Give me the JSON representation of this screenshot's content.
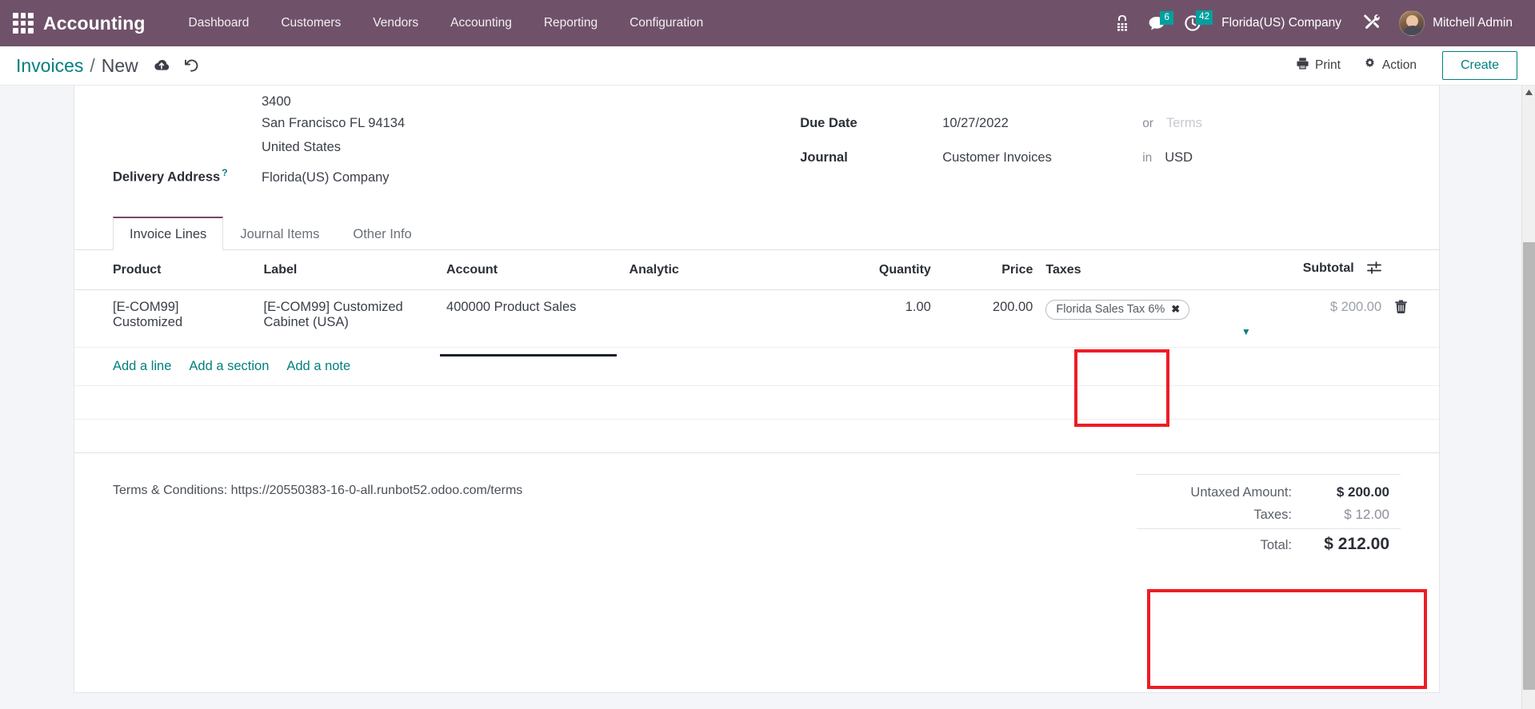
{
  "navbar": {
    "apps_icon": "apps-grid-icon",
    "brand": "Accounting",
    "menu": [
      {
        "label": "Dashboard"
      },
      {
        "label": "Customers"
      },
      {
        "label": "Vendors"
      },
      {
        "label": "Accounting"
      },
      {
        "label": "Reporting"
      },
      {
        "label": "Configuration"
      }
    ],
    "icons": {
      "voip": "phone-dialpad-icon",
      "messages": "chat-bubble-icon",
      "activities": "clock-icon",
      "tools": "wrench-screwdriver-icon"
    },
    "messages_count": "6",
    "activities_count": "42",
    "company": "Florida(US) Company",
    "user": "Mitchell Admin",
    "badge_color": "#00a09d",
    "bg_color": "#6f526a"
  },
  "control_panel": {
    "breadcrumb_root": "Invoices",
    "breadcrumb_sep": "/",
    "breadcrumb_current": "New",
    "save_icon": "cloud-upload-icon",
    "discard_icon": "undo-icon",
    "print_label": "Print",
    "print_icon": "printer-icon",
    "action_label": "Action",
    "action_icon": "gear-icon",
    "create_label": "Create",
    "accent_color": "#00807f"
  },
  "form": {
    "address_lines": [
      "3400",
      "San Francisco FL 94134",
      "United States"
    ],
    "delivery_address_label": "Delivery Address",
    "delivery_address_help": "?",
    "delivery_address_value": "Florida(US) Company",
    "due_date_label": "Due Date",
    "due_date_value": "10/27/2022",
    "due_date_conj": "or",
    "terms_placeholder": "Terms",
    "journal_label": "Journal",
    "journal_value": "Customer Invoices",
    "journal_conj": "in",
    "currency": "USD"
  },
  "tabs": [
    {
      "label": "Invoice Lines",
      "active": true
    },
    {
      "label": "Journal Items",
      "active": false
    },
    {
      "label": "Other Info",
      "active": false
    }
  ],
  "lines_table": {
    "columns": {
      "product": "Product",
      "label": "Label",
      "account": "Account",
      "analytic": "Analytic",
      "quantity": "Quantity",
      "price": "Price",
      "taxes": "Taxes",
      "subtotal": "Subtotal"
    },
    "optional_columns_icon": "sliders-icon",
    "row": {
      "product": "[E-COM99] Customized",
      "label": "[E-COM99] Customized Cabinet (USA)",
      "account": "400000 Product Sales",
      "analytic": "",
      "quantity": "1.00",
      "price": "200.00",
      "tax_tag": "Florida Sales Tax 6%",
      "tax_remove_icon": "close-x-icon",
      "tax_dropdown_icon": "caret-down-icon",
      "subtotal": "$ 200.00",
      "delete_icon": "trash-icon"
    },
    "add_line": "Add a line",
    "add_section": "Add a section",
    "add_note": "Add a note"
  },
  "footer": {
    "terms_text": "Terms & Conditions: https://20550383-16-0-all.runbot52.odoo.com/terms",
    "totals": {
      "untaxed_label": "Untaxed Amount:",
      "untaxed_value": "$ 200.00",
      "taxes_label": "Taxes:",
      "taxes_value": "$ 12.00",
      "total_label": "Total:",
      "total_value": "$ 212.00"
    }
  },
  "annotations": {
    "highlight_color": "#ee1c25",
    "boxes": [
      "taxes-field-highlight",
      "totals-highlight"
    ]
  }
}
